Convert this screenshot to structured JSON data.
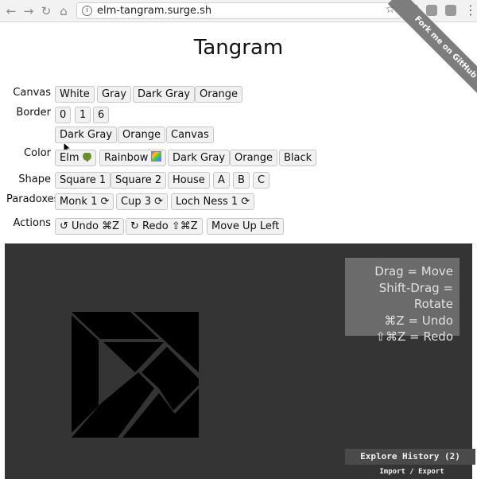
{
  "browser": {
    "url": "elm-tangram.surge.sh"
  },
  "page": {
    "title": "Tangram",
    "ribbon": "Fork me on GitHub"
  },
  "rows": {
    "canvas": {
      "label": "Canvas",
      "options": [
        "White",
        "Gray",
        "Dark Gray",
        "Orange"
      ]
    },
    "border": {
      "label": "Border",
      "widths": [
        "0",
        "1",
        "6"
      ],
      "colors": [
        "Dark Gray",
        "Orange",
        "Canvas"
      ]
    },
    "color": {
      "label": "Color",
      "options": [
        "Elm",
        "Rainbow",
        "Dark Gray",
        "Orange",
        "Black"
      ]
    },
    "shape": {
      "label": "Shape",
      "options": [
        "Square 1",
        "Square 2",
        "House",
        "A",
        "B",
        "C"
      ]
    },
    "paradoxes": {
      "label": "Paradoxes",
      "options": [
        "Monk 1",
        "Cup 3",
        "Loch Ness 1"
      ]
    },
    "actions": {
      "label": "Actions",
      "undo": "Undo ⌘Z",
      "redo": "Redo ⇧⌘Z",
      "move_up": "Move Up Left"
    }
  },
  "help": {
    "line1": "Drag = Move",
    "line2": "Shift-Drag = Rotate",
    "line3": "⌘Z = Undo",
    "line4": "⇧⌘Z = Redo"
  },
  "history": {
    "label": "Explore History (2)",
    "import_export": "Import / Export"
  },
  "colors": {
    "canvas": "#343434",
    "pieces": "#000000",
    "help_bg": "#6b6b6b"
  }
}
